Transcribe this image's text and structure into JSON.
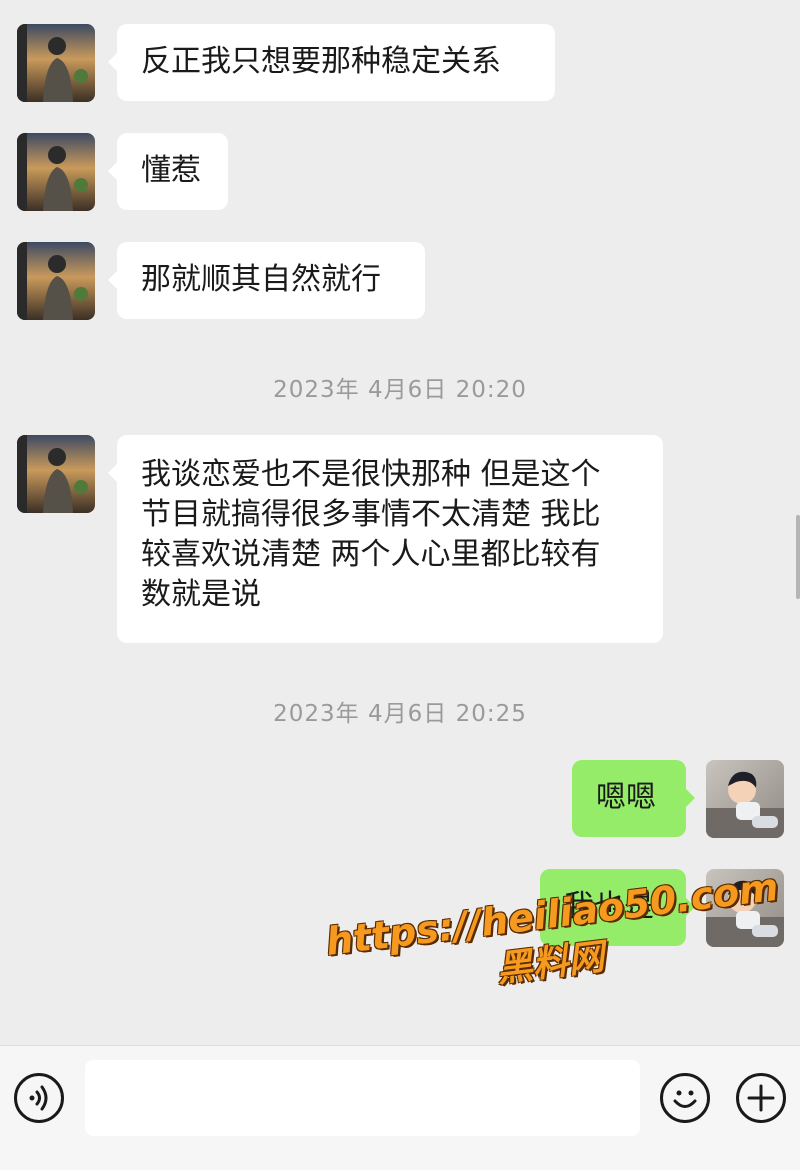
{
  "conversation": {
    "messages_before": [
      {
        "sender": "contact",
        "avatar": "contact-avatar",
        "text": "反正我只想要那种稳定关系"
      },
      {
        "sender": "contact",
        "avatar": "contact-avatar",
        "text": "懂惹"
      },
      {
        "sender": "contact",
        "avatar": "contact-avatar",
        "text": "那就顺其自然就行"
      }
    ],
    "timestamp_1": "2023年 4月6日 20:20",
    "long_message": {
      "sender": "contact",
      "lines": [
        "我谈恋爱也不是很快那种 但是这个",
        "节目就搞得很多事情不太清楚 我比",
        "较喜欢说清楚 两个人心里都比较有",
        "数就是说"
      ]
    },
    "timestamp_2": "2023年 4月6日 20:25",
    "messages_after": [
      {
        "sender": "self",
        "avatar": "self-avatar",
        "text": "嗯嗯"
      },
      {
        "sender": "self",
        "avatar": "self-avatar",
        "text": "我也是"
      }
    ]
  },
  "watermark": {
    "url": "https://heiliao50.com",
    "name": "黑料网"
  },
  "input_bar": {
    "voice_icon": "voice-icon",
    "emoji_icon": "emoji-icon",
    "plus_icon": "plus-icon",
    "text_value": ""
  },
  "colors": {
    "background": "#ededed",
    "incoming_bubble": "#ffffff",
    "outgoing_bubble": "#95ec69",
    "timestamp_text": "#9a9a9a",
    "watermark": "#f59a1f"
  }
}
